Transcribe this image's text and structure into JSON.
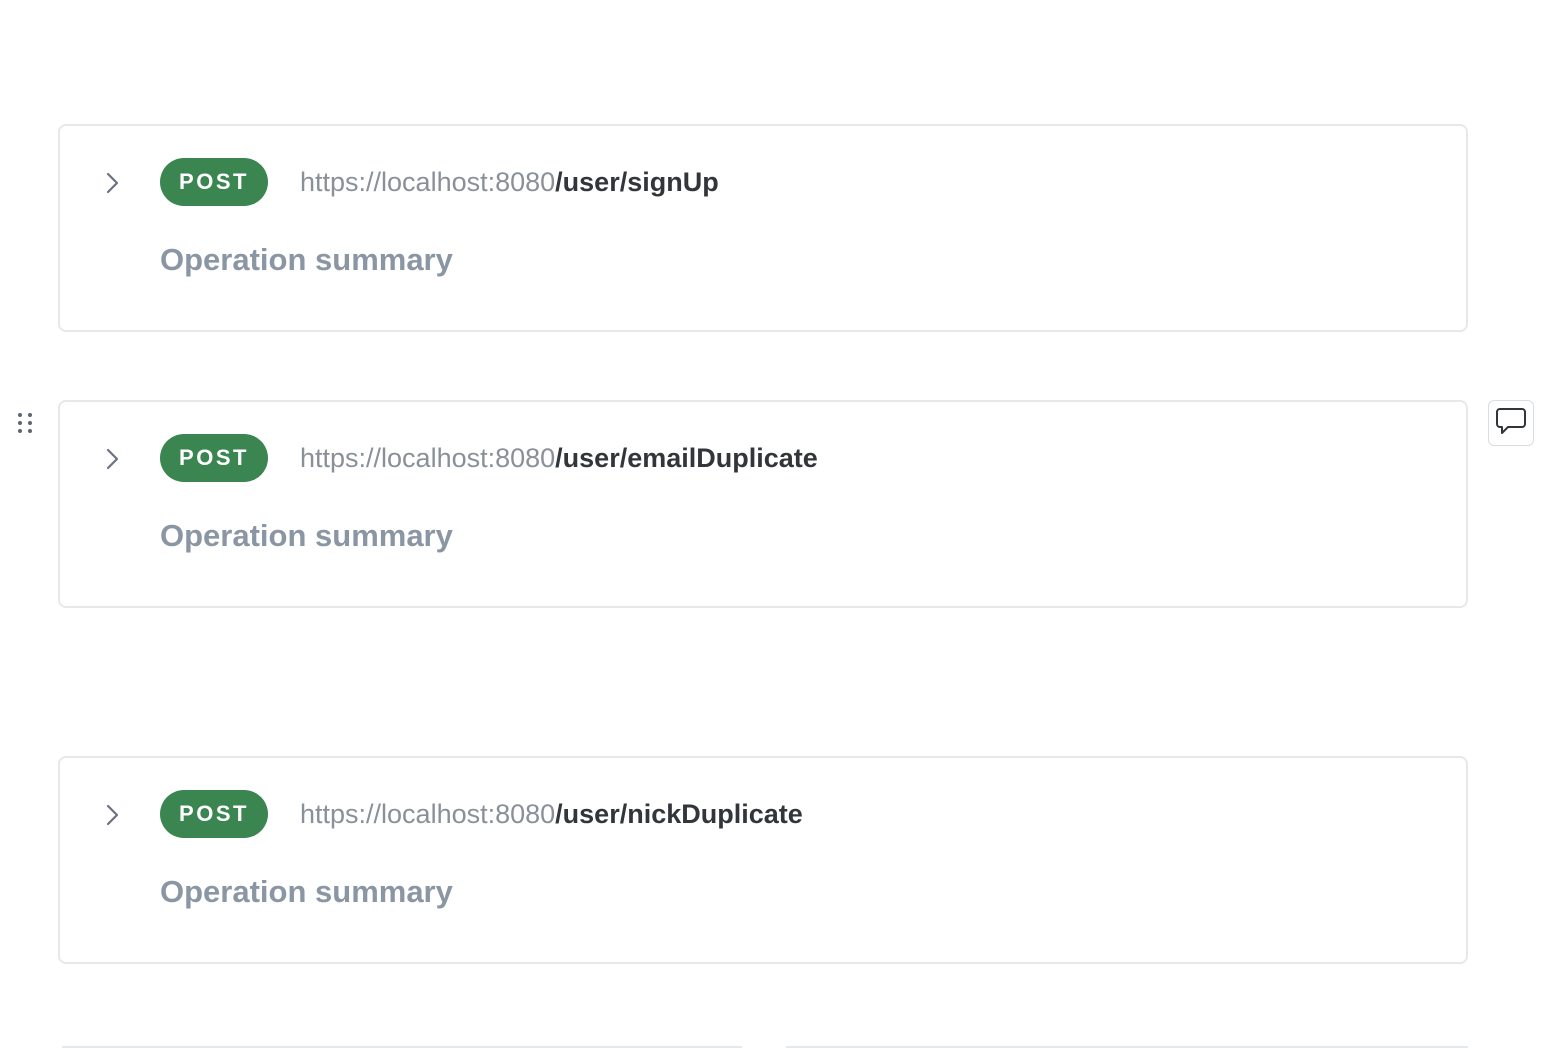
{
  "colors": {
    "post_badge": "#3a8550",
    "card_border": "#e6e8ea",
    "summary_text": "#8a96a3",
    "url_base_text": "#8a9099",
    "url_path_text": "#32363b"
  },
  "operations": [
    {
      "method": "POST",
      "base_url": "https://localhost:8080",
      "path": "/user/signUp",
      "summary": "Operation summary",
      "expand_icon": "chevron-right-icon"
    },
    {
      "method": "POST",
      "base_url": "https://localhost:8080",
      "path": "/user/emailDuplicate",
      "summary": "Operation summary",
      "expand_icon": "chevron-right-icon"
    },
    {
      "method": "POST",
      "base_url": "https://localhost:8080",
      "path": "/user/nickDuplicate",
      "summary": "Operation summary",
      "expand_icon": "chevron-right-icon"
    }
  ],
  "side_controls": {
    "drag_handle_icon": "drag-handle-icon",
    "comment_icon": "comment-icon"
  }
}
